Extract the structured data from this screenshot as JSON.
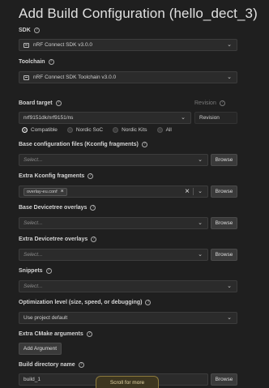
{
  "title": "Add Build Configuration (hello_dect_3)",
  "sdk": {
    "label": "SDK",
    "value": "nRF Connect SDK v3.0.0"
  },
  "toolchain": {
    "label": "Toolchain",
    "value": "nRF Connect SDK Toolchain v3.0.0"
  },
  "board": {
    "label": "Board target",
    "value": "nrf9151dk/nrf9151/ns",
    "revision_label": "Revision",
    "revision_placeholder": "Revision",
    "filters": [
      "Compatible",
      "Nordic SoC",
      "Nordic Kits",
      "All"
    ],
    "selected_filter": "Compatible"
  },
  "kconfig_fragments": {
    "label": "Base configuration files (Kconfig fragments)",
    "placeholder": "Select...",
    "button": "Browse"
  },
  "extra_kconfig": {
    "label": "Extra Kconfig fragments",
    "chip": "overlay-eu.conf",
    "button": "Browse"
  },
  "base_dt": {
    "label": "Base Devicetree overlays",
    "placeholder": "Select...",
    "button": "Browse"
  },
  "extra_dt": {
    "label": "Extra Devicetree overlays",
    "placeholder": "Select...",
    "button": "Browse"
  },
  "snippets": {
    "label": "Snippets",
    "placeholder": "Select..."
  },
  "optimization": {
    "label": "Optimization level (size, speed, or debugging)",
    "value": "Use project default"
  },
  "cmake": {
    "label": "Extra CMake arguments",
    "button": "Add Argument"
  },
  "build_dir": {
    "label": "Build directory name",
    "value": "build_1",
    "button": "Browse"
  },
  "scroll_hint": "Scroll for more"
}
